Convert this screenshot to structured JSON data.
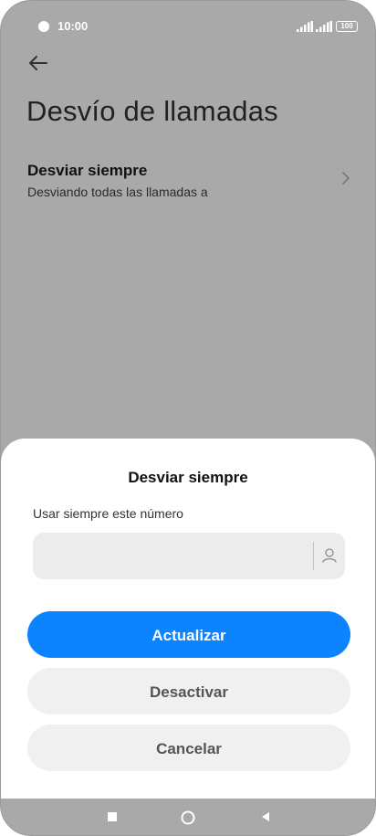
{
  "status_bar": {
    "time": "10:00",
    "battery": "100",
    "icons": [
      "signal-icon",
      "signal-icon",
      "battery-icon"
    ]
  },
  "header": {
    "back_icon": "arrow-left-icon",
    "title": "Desvío de llamadas"
  },
  "forward_item": {
    "title": "Desviar siempre",
    "subtitle": "Desviando todas las llamadas a",
    "icon": "chevron-right-icon"
  },
  "dialog": {
    "title": "Desviar siempre",
    "label": "Usar siempre este número",
    "input_value": "",
    "input_placeholder": "",
    "contact_icon": "person-icon",
    "buttons": {
      "update": "Actualizar",
      "deactivate": "Desactivar",
      "cancel": "Cancelar"
    }
  },
  "nav_bar": {
    "icons": [
      "square-recents-icon",
      "circle-home-icon",
      "triangle-back-icon"
    ]
  },
  "colors": {
    "background_dim": "#a9a9a9",
    "primary": "#0d84ff",
    "sheet": "#ffffff",
    "secondary_button": "#f0f0f0"
  }
}
